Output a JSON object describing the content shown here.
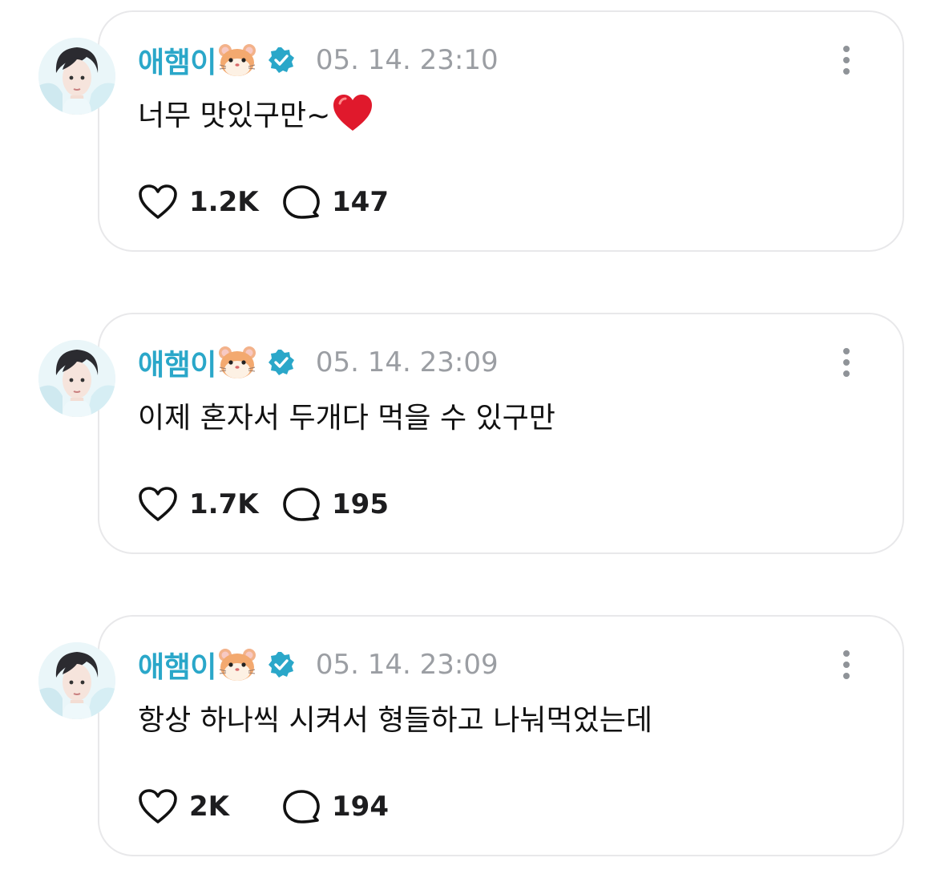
{
  "posts": [
    {
      "author": "애햄이",
      "author_emoji": "hamster-face-icon",
      "verified": true,
      "timestamp": "05. 14. 23:10",
      "text": "너무 맛있구만~",
      "text_emoji": "red-heart-icon",
      "likes": "1.2K",
      "replies": "147"
    },
    {
      "author": "애햄이",
      "author_emoji": "hamster-face-icon",
      "verified": true,
      "timestamp": "05. 14. 23:09",
      "text": "이제 혼자서 두개다 먹을 수 있구만",
      "text_emoji": "",
      "likes": "1.7K",
      "replies": "195"
    },
    {
      "author": "애햄이",
      "author_emoji": "hamster-face-icon",
      "verified": true,
      "timestamp": "05. 14. 23:09",
      "text": "항상 하나씩 시켜서 형들하고 나눠먹었는데",
      "text_emoji": "",
      "likes": "2K",
      "replies": "194"
    }
  ],
  "colors": {
    "username": "#2aa7c9",
    "verified_badge": "#2aa7c9",
    "timestamp": "#9b9ea3",
    "card_border": "#e8e8ea"
  },
  "icons": [
    "avatar",
    "hamster-face-icon",
    "verified-badge-icon",
    "more-options-icon",
    "heart-outline-icon",
    "reply-bubble-icon",
    "red-heart-icon"
  ]
}
